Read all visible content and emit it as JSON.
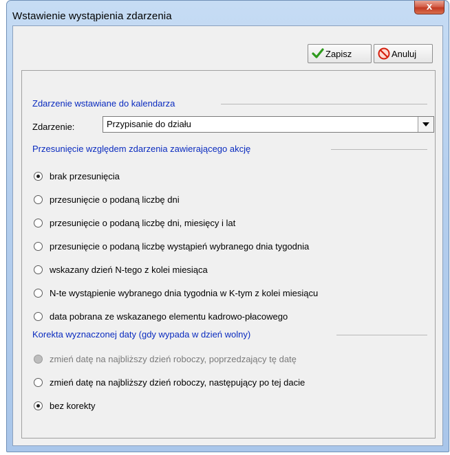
{
  "window": {
    "title": "Wstawienie wystąpienia zdarzenia",
    "close_label": "x"
  },
  "toolbar": {
    "save_label": "Zapisz",
    "cancel_label": "Anuluj"
  },
  "sections": {
    "event": "Zdarzenie wstawiane do kalendarza",
    "offset": "Przesunięcie względem zdarzenia zawierającego akcję",
    "correction": "Korekta wyznaczonej daty (gdy wypada w dzień wolny)"
  },
  "event_field": {
    "label": "Zdarzenie:",
    "value": "Przypisanie do działu"
  },
  "offset_options": [
    {
      "label": "brak przesunięcia",
      "checked": true
    },
    {
      "label": "przesunięcie o podaną liczbę dni",
      "checked": false
    },
    {
      "label": "przesunięcie o podaną liczbę dni, miesięcy i lat",
      "checked": false
    },
    {
      "label": "przesunięcie o podaną liczbę wystąpień wybranego dnia tygodnia",
      "checked": false
    },
    {
      "label": "wskazany dzień N-tego z kolei miesiąca",
      "checked": false
    },
    {
      "label": "N-te wystąpienie wybranego dnia tygodnia w K-tym z kolei miesiącu",
      "checked": false
    },
    {
      "label": "data pobrana ze wskazanego elementu kadrowo-płacowego",
      "checked": false
    }
  ],
  "correction_options": [
    {
      "label": "zmień datę na najbliższy dzień roboczy, poprzedzający tę datę",
      "checked": false,
      "disabled": true
    },
    {
      "label": "zmień datę na najbliższy dzień roboczy, następujący po tej dacie",
      "checked": false,
      "disabled": false
    },
    {
      "label": "bez korekty",
      "checked": true,
      "disabled": false
    }
  ]
}
